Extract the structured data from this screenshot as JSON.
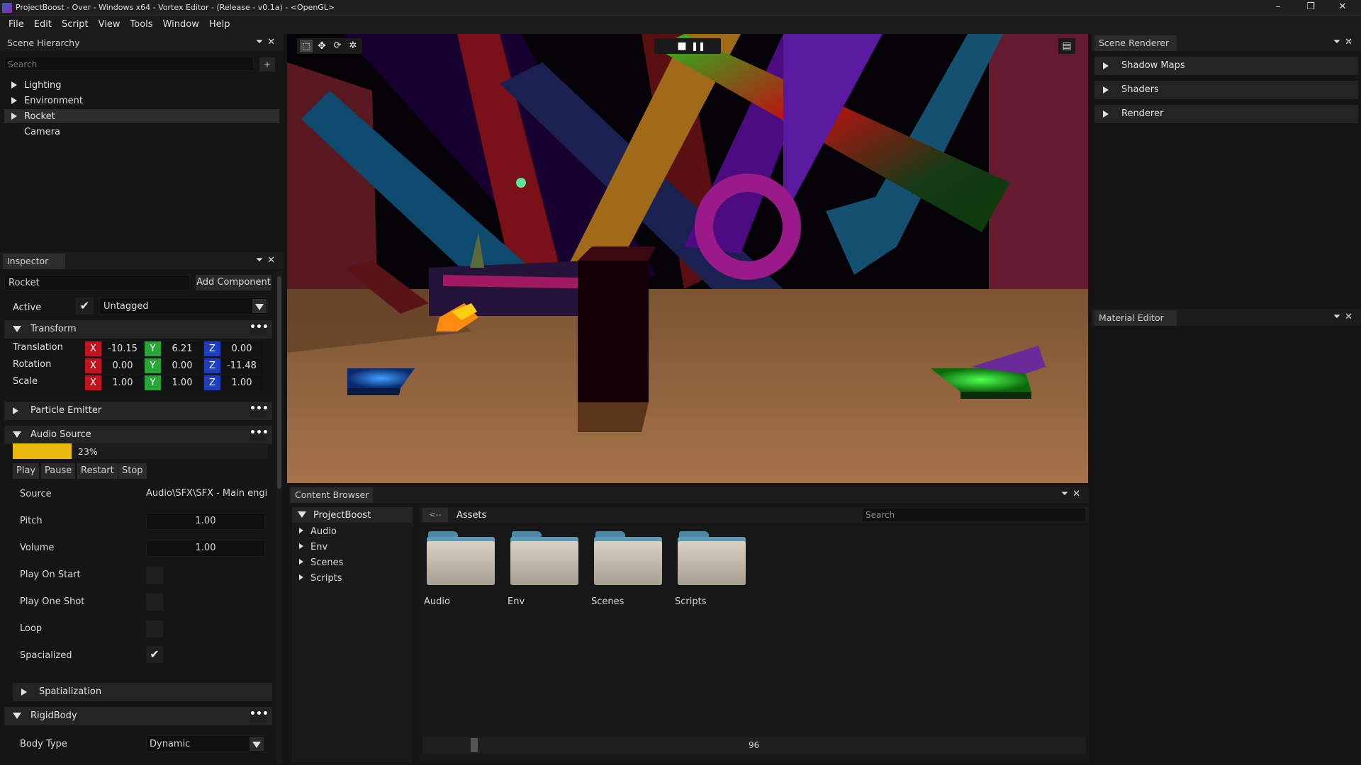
{
  "window": {
    "title": "ProjectBoost - Over - Windows x64 - Vortex Editor - (Release - v0.1a) - <OpenGL>",
    "controls": [
      "–",
      "❐",
      "✕"
    ]
  },
  "menu": [
    "File",
    "Edit",
    "Script",
    "View",
    "Tools",
    "Window",
    "Help"
  ],
  "hierarchy": {
    "tab": "Scene Hierarchy",
    "search_placeholder": "Search",
    "add": "+",
    "items": [
      {
        "label": "Lighting",
        "expandable": true,
        "selected": false
      },
      {
        "label": "Environment",
        "expandable": true,
        "selected": false
      },
      {
        "label": "Rocket",
        "expandable": true,
        "selected": true
      },
      {
        "label": "Camera",
        "expandable": false,
        "selected": false
      }
    ]
  },
  "inspector": {
    "tab": "Inspector",
    "entity_name": "Rocket",
    "add_component": "Add Component",
    "active_label": "Active",
    "active_checked": true,
    "tag": "Untagged",
    "transform": {
      "title": "Transform",
      "rows": [
        {
          "label": "Translation",
          "x": "-10.15",
          "y": "6.21",
          "z": "0.00"
        },
        {
          "label": "Rotation",
          "x": "0.00",
          "y": "0.00",
          "z": "-11.48"
        },
        {
          "label": "Scale",
          "x": "1.00",
          "y": "1.00",
          "z": "1.00"
        }
      ],
      "axis_labels": [
        "X",
        "Y",
        "Z"
      ]
    },
    "particle_emitter": {
      "title": "Particle Emitter"
    },
    "audio_source": {
      "title": "Audio Source",
      "progress": 0.23,
      "progress_text": "23%",
      "buttons": [
        "Play",
        "Pause",
        "Restart",
        "Stop"
      ],
      "source_label": "Source",
      "source_value": "Audio\\SFX\\SFX - Main engir",
      "pitch_label": "Pitch",
      "pitch_value": "1.00",
      "volume_label": "Volume",
      "volume_value": "1.00",
      "play_on_start_label": "Play On Start",
      "play_on_start": false,
      "play_one_shot_label": "Play One Shot",
      "play_one_shot": false,
      "loop_label": "Loop",
      "loop": false,
      "spacialized_label": "Spacialized",
      "spacialized": true,
      "spatialization": "Spatialization"
    },
    "rigidbody": {
      "title": "RigidBody",
      "body_type_label": "Body Type",
      "body_type": "Dynamic"
    },
    "more": "•••"
  },
  "viewport": {
    "tools": [
      "select-tool-icon",
      "move-tool-icon",
      "rotate-tool-icon",
      "scale-tool-icon"
    ],
    "stop": "■",
    "pause": "❚❚"
  },
  "scene_renderer": {
    "tab": "Scene Renderer",
    "sections": [
      "Shadow Maps",
      "Shaders",
      "Renderer"
    ]
  },
  "material_editor": {
    "tab": "Material Editor"
  },
  "content_browser": {
    "tab": "Content Browser",
    "tree_root": "ProjectBoost",
    "tree_children": [
      "Audio",
      "Env",
      "Scenes",
      "Scripts"
    ],
    "back": "<--",
    "path": "Assets",
    "search_placeholder": "Search",
    "folders": [
      "Audio",
      "Env",
      "Scenes",
      "Scripts"
    ],
    "thumbnail_size": "96"
  },
  "colors": {
    "axis_x": "#c4131f",
    "axis_y": "#2aa53a",
    "axis_z": "#1b3fc0",
    "progress_fill": "#e8b90f",
    "folder_tab": "#4a8aa8"
  }
}
